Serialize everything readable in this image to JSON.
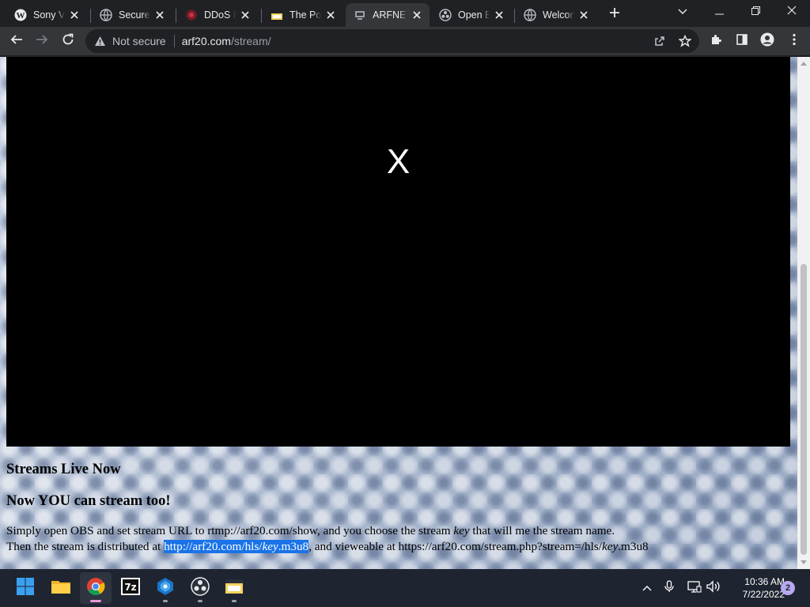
{
  "browser": {
    "tabs": [
      {
        "title": "Sony Vegas Pro",
        "icon": "wordpress-icon"
      },
      {
        "title": "Secure Proxy",
        "icon": "globe-icon"
      },
      {
        "title": "DDoS Protection",
        "icon": "ddos-icon"
      },
      {
        "title": "The Power",
        "icon": "clapperboard-icon"
      },
      {
        "title": "ARFNET",
        "icon": "arfnet-icon",
        "active": true
      },
      {
        "title": "Open Broadcaster",
        "icon": "obs-icon"
      },
      {
        "title": "Welcome",
        "icon": "globe-icon"
      }
    ],
    "security_label": "Not secure",
    "url_host": "arf20.com",
    "url_path": "/stream/"
  },
  "page": {
    "player_error": "X",
    "heading_live": "Streams Live Now",
    "heading_stream": "Now YOU can stream too!",
    "line1": {
      "before": "Simply open OBS and set stream URL to rtmp://arf20.com/show, and you choose the stream ",
      "key": "key",
      "after": " that will me the stream name."
    },
    "line2": {
      "before": "Then the stream is distributed at ",
      "link_pre": "http://arf20.com/hls/",
      "link_key": "key",
      "link_post": ".m3u8",
      "middle": ", and vieweable at https://arf20.com/stream.php?stream=/hls/",
      "key": "key",
      "after": ".m3u8"
    }
  },
  "taskbar": {
    "apps": [
      "windows-start-icon",
      "file-explorer-icon",
      "chrome-icon",
      "7zip-icon",
      "network-app-icon",
      "obs-icon",
      "media-app-icon"
    ],
    "time": "10:36 AM",
    "date": "7/22/2022",
    "notification_count": "2"
  },
  "colors": {
    "tab_strip": "#202124",
    "toolbar": "#35363a",
    "selection": "#1a73e8",
    "taskbar": "#1f2530"
  }
}
